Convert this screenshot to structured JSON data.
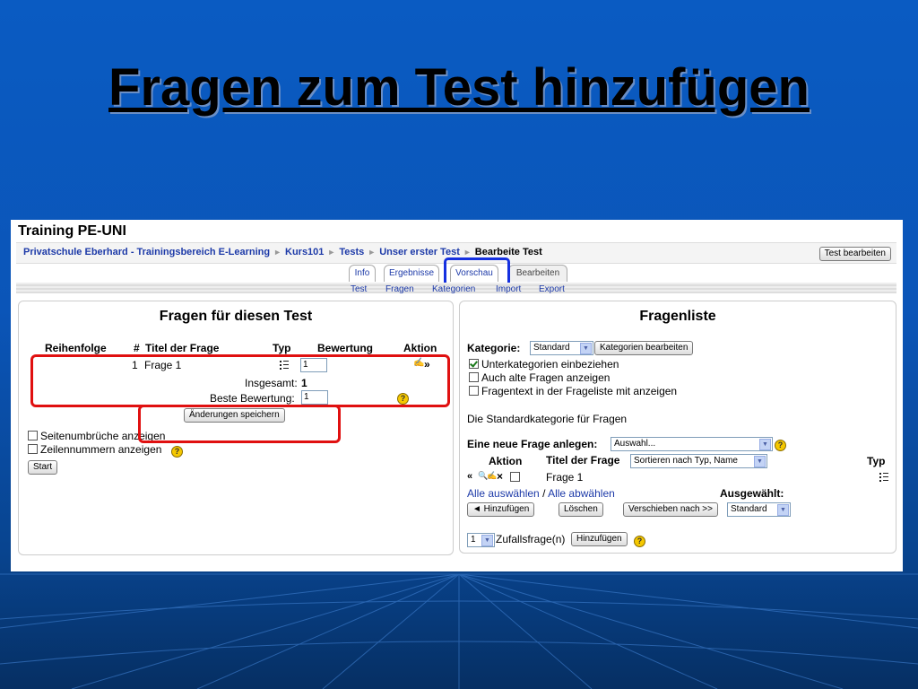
{
  "slide": {
    "title": "Fragen zum Test hinzufügen"
  },
  "site": {
    "title": "Training PE-UNI"
  },
  "breadcrumb": {
    "items": [
      "Privatschule Eberhard - Trainingsbereich E-Learning",
      "Kurs101",
      "Tests",
      "Unser erster Test"
    ],
    "current": "Bearbeite Test",
    "separator": "►"
  },
  "header": {
    "edit_test_label": "Test bearbeiten"
  },
  "tabs": [
    {
      "label": "Info"
    },
    {
      "label": "Ergebnisse"
    },
    {
      "label": "Vorschau"
    },
    {
      "label": "Bearbeiten",
      "active": true
    }
  ],
  "subtabs": [
    {
      "label": "Test"
    },
    {
      "label": "Fragen"
    },
    {
      "label": "Kategorien"
    },
    {
      "label": "Import"
    },
    {
      "label": "Export"
    }
  ],
  "quiz_panel": {
    "title": "Fragen für diesen Test",
    "columns": [
      "Reihenfolge",
      "#",
      "Titel der Frage",
      "Typ",
      "Bewertung",
      "Aktion"
    ],
    "rows": [
      {
        "number": "1",
        "title": "Frage 1",
        "grade": "1",
        "action": "»"
      }
    ],
    "total_label": "Insgesamt:",
    "total_value": "1",
    "best_grade_label": "Beste Bewertung:",
    "best_grade_value": "1",
    "save_button": "Änderungen speichern",
    "page_breaks_label": "Seitenumbrüche anzeigen",
    "line_numbers_label": "Zeilennummern anzeigen",
    "start_button": "Start"
  },
  "bank_panel": {
    "title": "Fragenliste",
    "category_label": "Kategorie:",
    "category_value": "Standard",
    "edit_categories_button": "Kategorien bearbeiten",
    "option_subcategories": "Unterkategorien einbeziehen",
    "option_old_questions": "Auch alte Fragen anzeigen",
    "option_question_text": "Fragentext in der Frageliste mit anzeigen",
    "category_description": "Die Standardkategorie für Fragen",
    "new_question_label": "Eine neue Frage anlegen:",
    "new_question_value": "Auswahl...",
    "col_action": "Aktion",
    "col_title": "Titel der Frage",
    "sort_value": "Sortieren nach Typ, Name",
    "col_type": "Typ",
    "rows": [
      {
        "title": "Frage 1"
      }
    ],
    "select_all": "Alle auswählen",
    "select_sep": "/",
    "deselect_all": "Alle abwählen",
    "selected_label": "Ausgewählt:",
    "add_button": "◄ Hinzufügen",
    "delete_button": "Löschen",
    "move_button": "Verschieben nach >>",
    "move_target": "Standard",
    "random_count": "1",
    "random_label": "Zufallsfrage(n)",
    "random_add_button": "Hinzufügen"
  },
  "colors": {
    "highlight_red": "#e01010",
    "highlight_blue": "#1530e0",
    "link": "#1d3aa8"
  }
}
